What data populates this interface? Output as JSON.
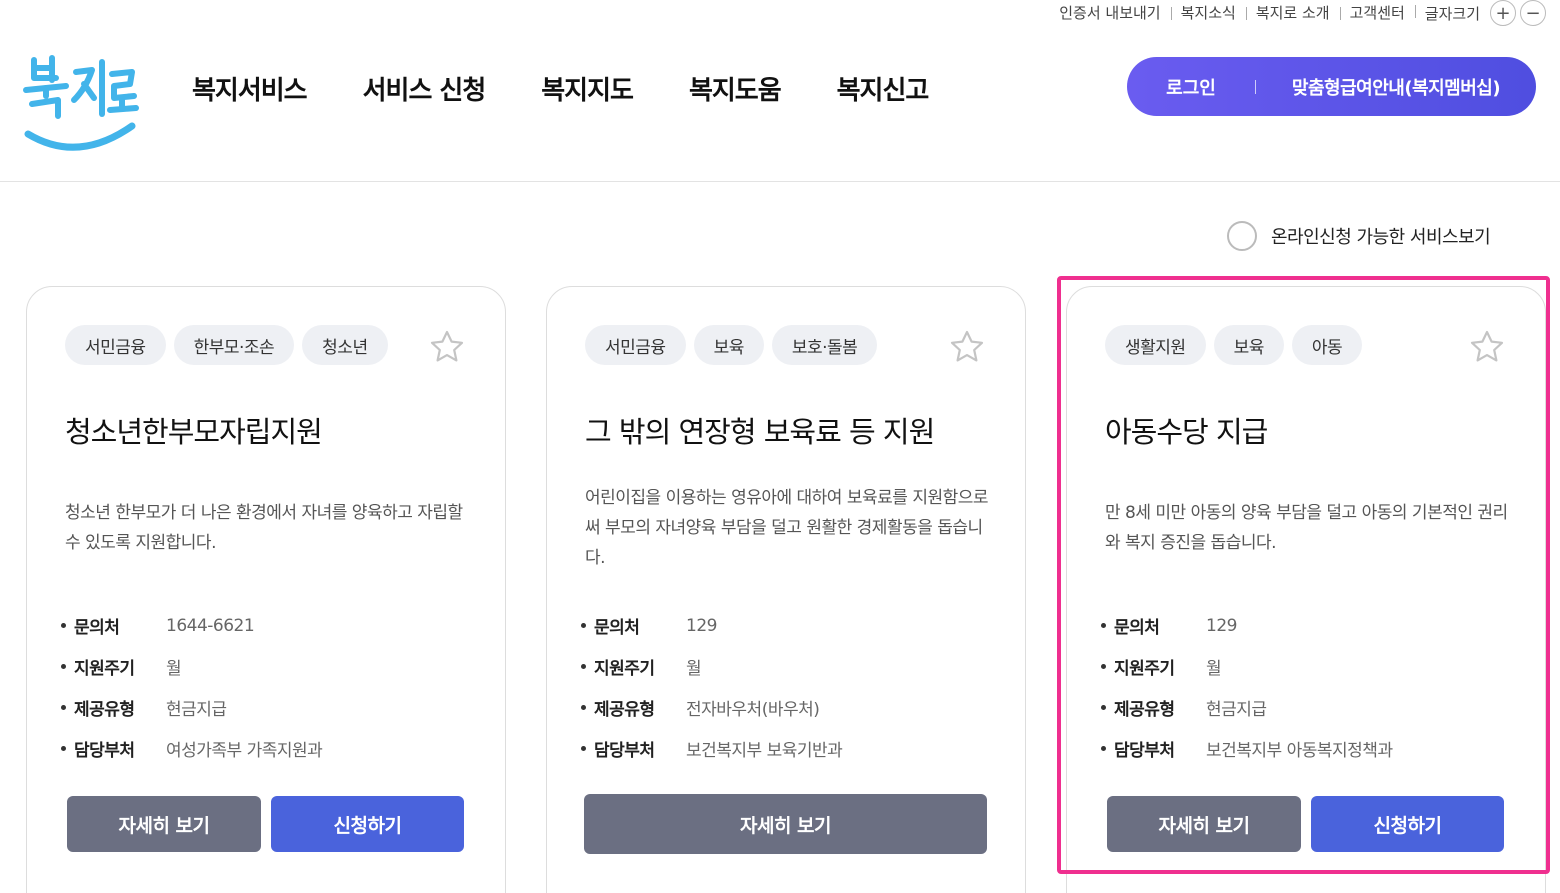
{
  "utility": {
    "links": [
      "인증서 내보내기",
      "복지소식",
      "복지로 소개",
      "고객센터"
    ],
    "font_size_label": "글자크기",
    "increase": "+",
    "decrease": "−"
  },
  "header": {
    "logo_text": "복지로",
    "nav": [
      "복지서비스",
      "서비스 신청",
      "복지지도",
      "복지도움",
      "복지신고"
    ],
    "login_label": "로그인",
    "member_label": "맞춤형급여안내(복지멤버십)"
  },
  "filter": {
    "label": "온라인신청 가능한 서비스보기",
    "checked": false
  },
  "cards": [
    {
      "tags": [
        "서민금융",
        "한부모·조손",
        "청소년"
      ],
      "title": "청소년한부모자립지원",
      "description": "청소년 한부모가 더 나은 환경에서 자녀를 양육하고 자립할 수 있도록 지원합니다.",
      "info": [
        {
          "key": "문의처",
          "value": "1644-6621"
        },
        {
          "key": "지원주기",
          "value": "월"
        },
        {
          "key": "제공유형",
          "value": "현금지급"
        },
        {
          "key": "담당부처",
          "value": "여성가족부 가족지원과"
        }
      ],
      "detail_label": "자세히 보기",
      "apply_label": "신청하기",
      "favorited": false
    },
    {
      "tags": [
        "서민금융",
        "보육",
        "보호·돌봄"
      ],
      "title": "그 밖의 연장형 보육료 등 지원",
      "description": "어린이집을 이용하는 영유아에 대하여 보육료를 지원함으로써  부모의 자녀양육 부담을 덜고 원활한 경제활동을 돕습니다.",
      "info": [
        {
          "key": "문의처",
          "value": "129"
        },
        {
          "key": "지원주기",
          "value": "월"
        },
        {
          "key": "제공유형",
          "value": "전자바우처(바우처)"
        },
        {
          "key": "담당부처",
          "value": "보건복지부 보육기반과"
        }
      ],
      "detail_label": "자세히 보기",
      "favorited": false
    },
    {
      "tags": [
        "생활지원",
        "보육",
        "아동"
      ],
      "title": "아동수당 지급",
      "description": "만 8세 미만 아동의 양육 부담을 덜고 아동의 기본적인 권리와 복지 증진을 돕습니다.",
      "info": [
        {
          "key": "문의처",
          "value": "129"
        },
        {
          "key": "지원주기",
          "value": "월"
        },
        {
          "key": "제공유형",
          "value": "현금지급"
        },
        {
          "key": "담당부처",
          "value": "보건복지부 아동복지정책과"
        }
      ],
      "detail_label": "자세히 보기",
      "apply_label": "신청하기",
      "favorited": false,
      "highlighted": true
    }
  ],
  "colors": {
    "primary_button": "#4a63dc",
    "secondary_button": "#6b6f82",
    "login_gradient_start": "#6a5cf0",
    "highlight": "#ef2f8f",
    "logo_blue": "#42b4ea"
  }
}
